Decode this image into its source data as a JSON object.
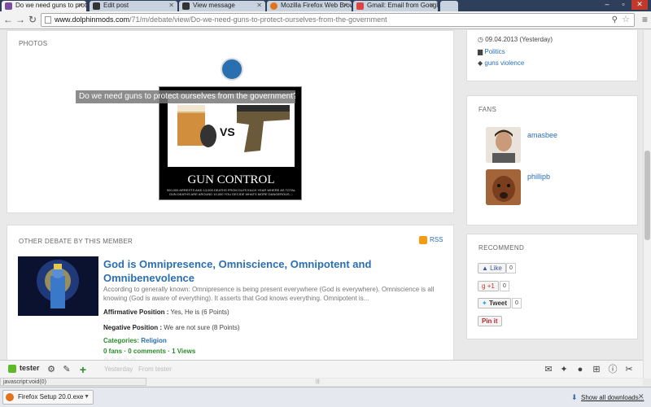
{
  "browser": {
    "tabs": [
      {
        "label": "Do we need guns to prote",
        "active": true
      },
      {
        "label": "Edit post",
        "active": false
      },
      {
        "label": "View message",
        "active": false
      },
      {
        "label": "Mozilla Firefox Web Brow",
        "active": false
      },
      {
        "label": "Gmail: Email from Google",
        "active": false
      }
    ],
    "url_host": "www.dolphinmods.com",
    "url_path": "/71/m/debate/view/Do-we-need-guns-to-protect-ourselves-from-the-government"
  },
  "photos": {
    "section_title": "PHOTOS",
    "caption": "Do we need guns to protect ourselves from the government?",
    "image_title": "GUN CONTROL",
    "image_subtitle": "900,000 ARRESTS AND 13,000 DEATHS FROM DUI'S EACH YEAR WHERE AS TOTAL GUN DEATHS ARE AROUND 10,000 YOU DECIDE WHATS MORE DANGEROUS....",
    "vs_text": "VS"
  },
  "other_debate": {
    "section_title": "OTHER DEBATE BY THIS MEMBER",
    "rss_label": "RSS",
    "title": "God is Omnipresence, Omniscience, Omnipotent and Omnibenevolence",
    "description": "According to generally known: Omnipresence is being present everywhere (God is everywhere). Omniscience is all knowing (God is aware of everything). It asserts that God knows everything. Omnipotent is...",
    "affirmative_label": "Affirmative Position :",
    "affirmative_value": "Yes, He is (6 Points)",
    "negative_label": "Negative Position :",
    "negative_value": "We are not sure (8 Points)",
    "categories_label": "Categories:",
    "categories_value": "Religion",
    "fans": "0 fans",
    "comments": "0 comments",
    "views": "1 Views",
    "stars": "☆☆☆☆☆"
  },
  "sidebar": {
    "date": "09.04.2013 (Yesterday)",
    "category": "Politics",
    "tag": "guns violence",
    "fans_title": "FANS",
    "fans": [
      {
        "name": "amasbee"
      },
      {
        "name": "phillipb"
      }
    ],
    "recommend_title": "RECOMMEND",
    "like_label": "Like",
    "like_count": "0",
    "gplus_label": "+1",
    "gplus_count": "0",
    "tweet_label": "Tweet",
    "tweet_count": "0",
    "pinit_label": "Pin it"
  },
  "toolbar": {
    "user": "tester",
    "faint_text_1": "Yesterday",
    "faint_text_2": "From tester"
  },
  "status": {
    "text": "javascript:void(0)"
  },
  "downloads": {
    "item": "Firefox Setup 20.0.exe",
    "show_all": "Show all downloads..."
  },
  "colors": {
    "link": "#2a6fb0",
    "green": "#2a8a2a",
    "tabbar": "#2d3f5a"
  }
}
